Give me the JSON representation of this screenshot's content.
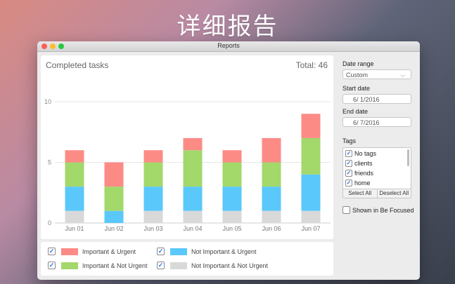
{
  "hero": {
    "title": "详细报告"
  },
  "window": {
    "title": "Reports"
  },
  "report": {
    "title": "Completed tasks",
    "total": "Total: 46"
  },
  "chart_data": {
    "type": "bar",
    "stacked": true,
    "title": "Completed tasks",
    "categories": [
      "Jun 01",
      "Jun 02",
      "Jun 03",
      "Jun 04",
      "Jun 05",
      "Jun 06",
      "Jun 07"
    ],
    "series": [
      {
        "name": "Not Important & Not Urgent",
        "color": "#d9d9d9",
        "values": [
          1,
          0,
          1,
          1,
          1,
          1,
          1
        ]
      },
      {
        "name": "Not Important & Urgent",
        "color": "#5ac8fa",
        "values": [
          2,
          1,
          2,
          2,
          2,
          2,
          3
        ]
      },
      {
        "name": "Important & Not Urgent",
        "color": "#a3d86b",
        "values": [
          2,
          2,
          2,
          3,
          2,
          2,
          3
        ]
      },
      {
        "name": "Important & Urgent",
        "color": "#fc8b86",
        "values": [
          1,
          2,
          1,
          1,
          1,
          2,
          2
        ]
      }
    ],
    "yticks": [
      0,
      5,
      10
    ],
    "ylim": [
      0,
      10
    ],
    "grid": true
  },
  "legend": [
    {
      "label": "Important & Urgent",
      "color": "#fc8b86",
      "checked": true
    },
    {
      "label": "Important & Not Urgent",
      "color": "#a3d86b",
      "checked": true
    },
    {
      "label": "Not Important & Urgent",
      "color": "#5ac8fa",
      "checked": true
    },
    {
      "label": "Not Important & Not Urgent",
      "color": "#d9d9d9",
      "checked": true
    }
  ],
  "sidebar": {
    "date_range_label": "Date range",
    "date_range_value": "Custom",
    "start_label": "Start date",
    "start_value": "6/  1/2016",
    "end_label": "End date",
    "end_value": "6/  7/2016",
    "tags_label": "Tags",
    "tags": [
      {
        "label": "No tags",
        "checked": true
      },
      {
        "label": "clients",
        "checked": true
      },
      {
        "label": "friends",
        "checked": true
      },
      {
        "label": "home",
        "checked": true
      }
    ],
    "select_all": "Select All",
    "deselect_all": "Deselect All",
    "shown_label": "Shown in Be Focused",
    "shown_checked": false
  }
}
